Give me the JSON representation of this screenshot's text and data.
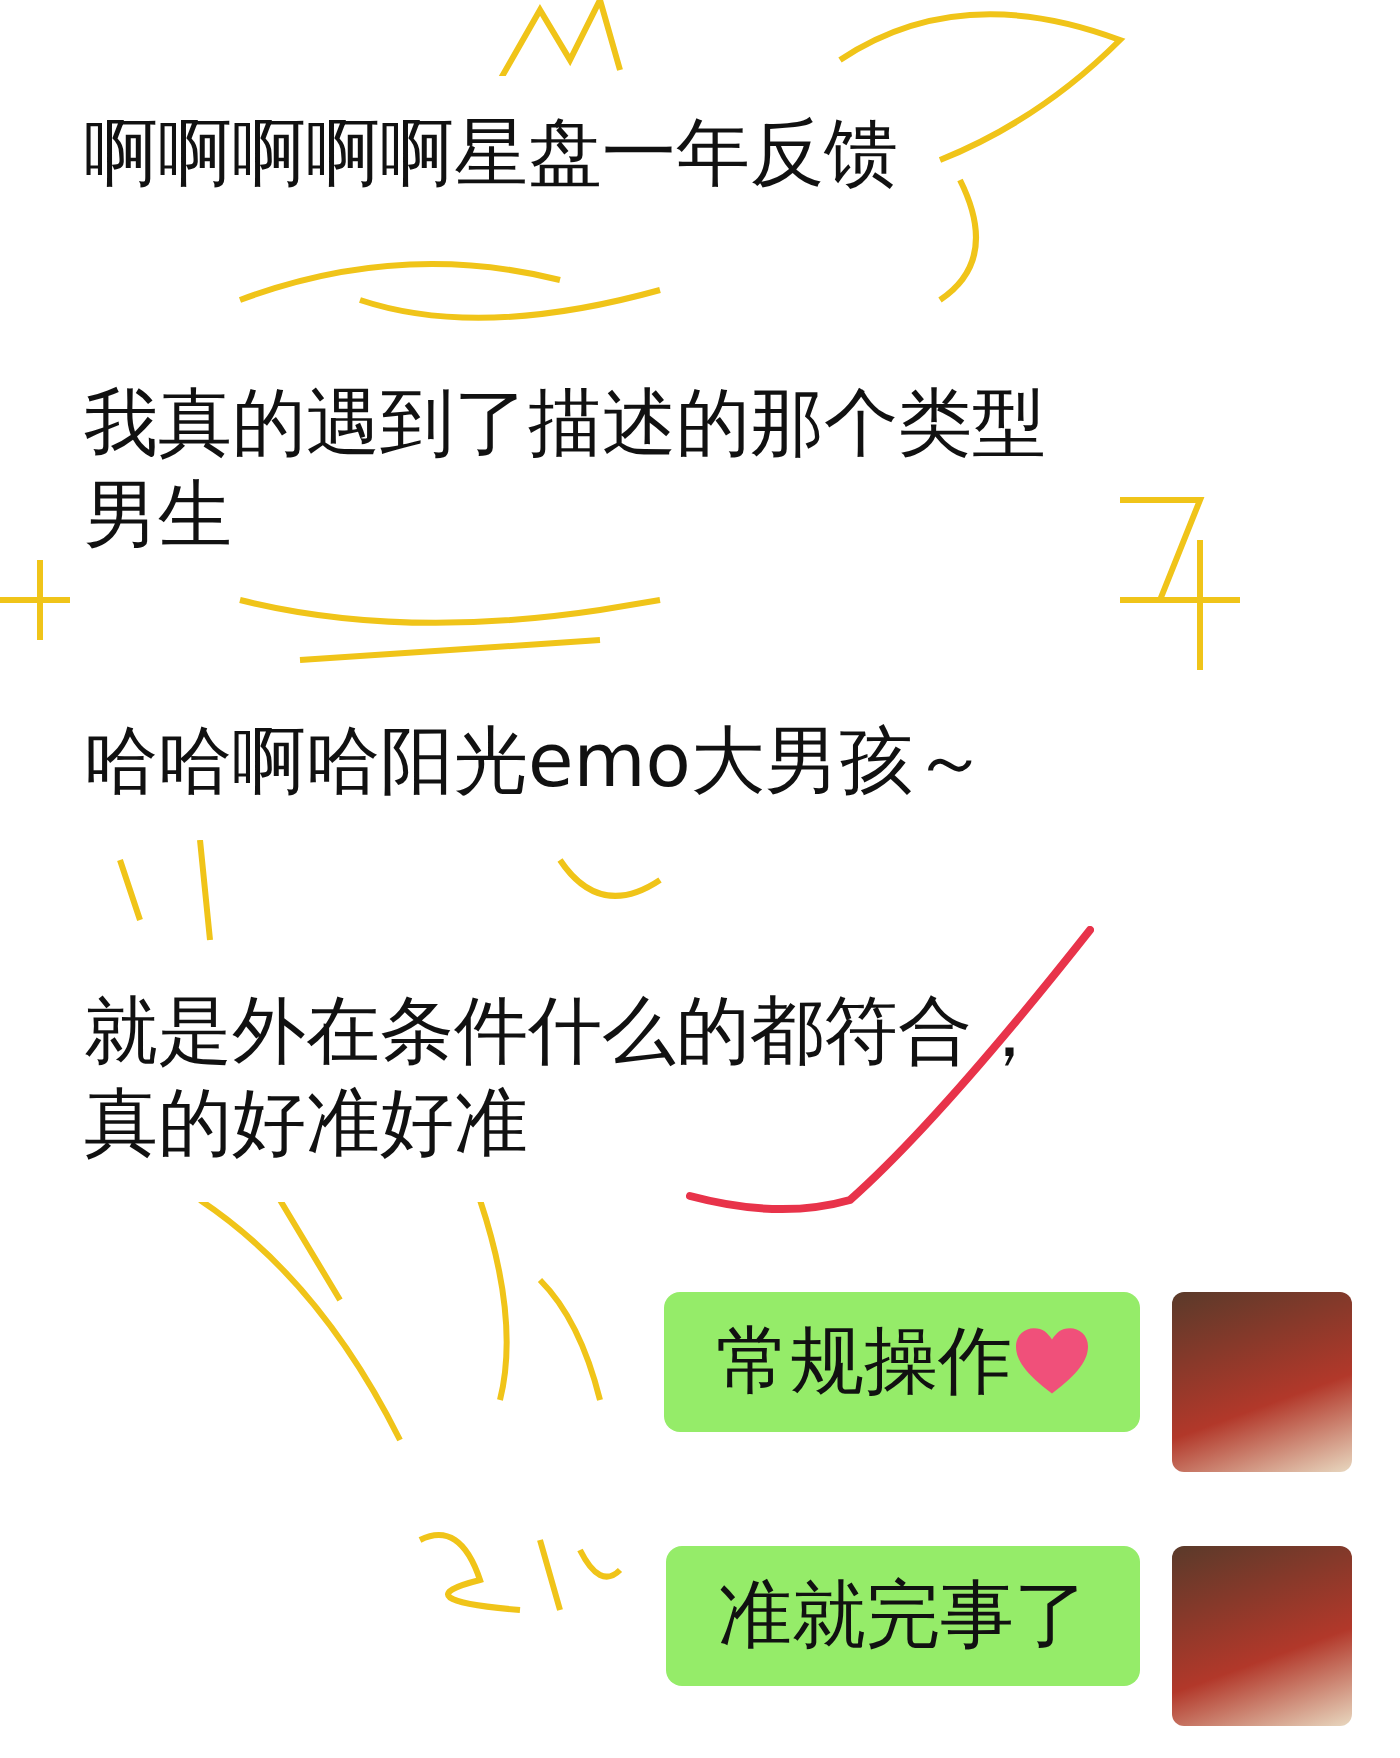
{
  "messages": [
    {
      "kind": "incoming",
      "text": "啊啊啊啊啊星盘一年反馈"
    },
    {
      "kind": "incoming",
      "text": "我真的遇到了描述的那个类型男生"
    },
    {
      "kind": "incoming",
      "text": "哈哈啊哈阳光emo大男孩～"
    },
    {
      "kind": "incoming",
      "text": "就是外在条件什么的都符合，真的好准好准"
    },
    {
      "kind": "outgoing",
      "text": "常规操作",
      "heart": true
    },
    {
      "kind": "outgoing",
      "text": "准就完事了",
      "heart": false
    }
  ]
}
